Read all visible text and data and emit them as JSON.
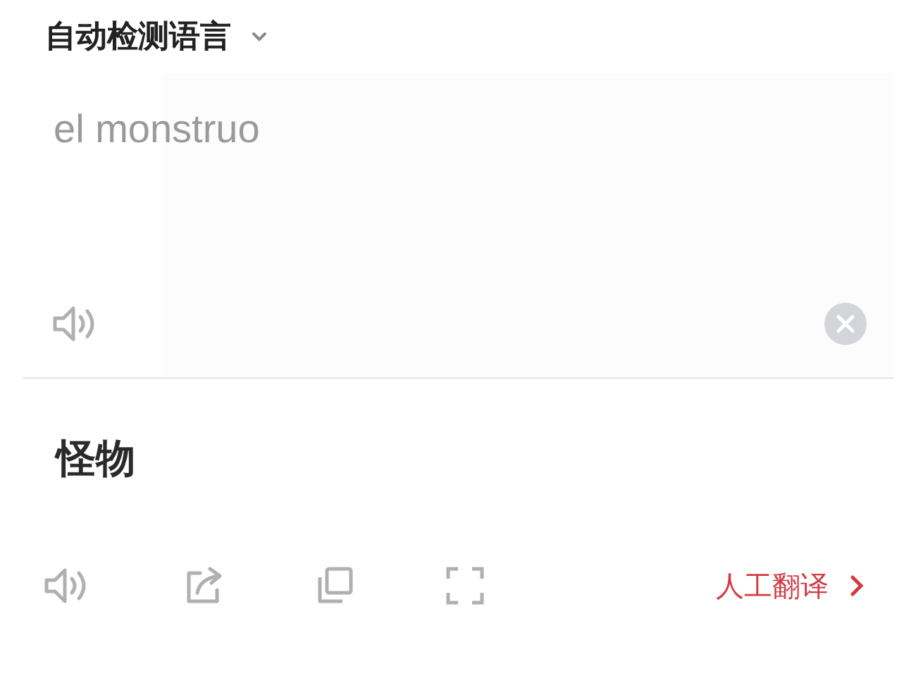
{
  "source_language": {
    "label": "自动检测语言"
  },
  "input": {
    "value": "el monstruo"
  },
  "result": {
    "text": "怪物"
  },
  "human_translation": {
    "label": "人工翻译"
  }
}
